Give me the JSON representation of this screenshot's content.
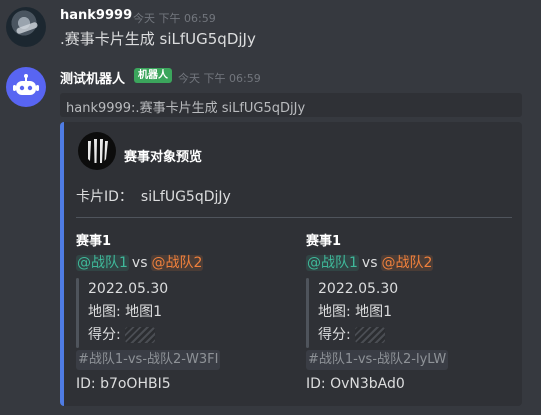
{
  "message1": {
    "username": "hank9999",
    "timestamp": "今天 下午 06:59",
    "content": ".赛事卡片生成 siLfUG5qDjJy"
  },
  "message2": {
    "username": "测试机器人",
    "badge": "机器人",
    "timestamp": "今天 下午 06:59",
    "reply_quote": "hank9999:.赛事卡片生成 siLfUG5qDjJy",
    "embed": {
      "accent_color": "#4f7ce3",
      "title": "赛事对象预览",
      "card_label": "卡片ID：",
      "card_value": "siLfUG5qDjJy",
      "fields": [
        {
          "name": "赛事1",
          "team1": "@战队1",
          "vs": "vs",
          "team2": "@战队2",
          "date": "2022.05.30",
          "map": "地图: 地图1",
          "score_label": "得分:",
          "channel": "#战队1-vs-战队2-W3FI",
          "id": "ID: b7oOHBI5"
        },
        {
          "name": "赛事1",
          "team1": "@战队1",
          "vs": "vs",
          "team2": "@战队2",
          "date": "2022.05.30",
          "map": "地图: 地图1",
          "score_label": "得分:",
          "channel": "#战队1-vs-战队2-lyLW",
          "id": "ID: OvN3bAd0"
        }
      ]
    }
  },
  "colors": {
    "background": "#36393f",
    "embed_background": "#2f3136",
    "bot_badge": "#3ba55c",
    "mention_green": "#3fb99a",
    "mention_orange": "#f0803c"
  },
  "icons": {
    "user_avatar": "user-avatar",
    "bot_avatar": "discord-bot-icon",
    "embed_thumbnail": "event-logo-icon"
  }
}
